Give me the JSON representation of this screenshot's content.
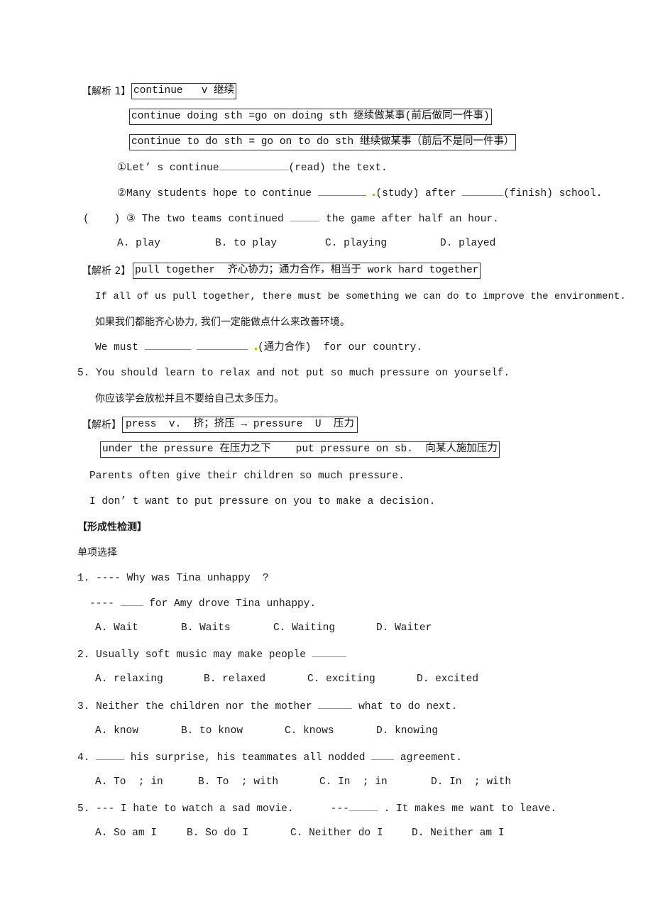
{
  "section1": {
    "label": "【解析 1】",
    "box_main": "continue   v 继续",
    "box_doing": "continue doing sth =go on doing sth 继续做某事(前后做同一件事)",
    "box_to_do": "continue to do sth = go on to do sth 继续做某事（前后不是同一件事）",
    "ex1_pre": "①Let’ s continue",
    "ex1_post": "(read) the text.",
    "ex2_pre": "②Many students hope to continue",
    "ex2_mid": "(study) after",
    "ex2_post": "(finish) school.",
    "ex3_paren": "(    )",
    "ex3_pre": "③ The two teams continued",
    "ex3_post": "the game after half an hour.",
    "ex3_options": [
      "A. play",
      "B. to play",
      "C. playing",
      "D. played"
    ]
  },
  "section2": {
    "label": "【解析 2】",
    "box": "pull together  齐心协力；通力合作，相当于 work hard together",
    "example_en": "If all of us pull together, there must be something we can do to improve the environment.",
    "example_zh": "如果我们都能齐心协力, 我们一定能做点什么来改善环境。",
    "fill_pre": "We must",
    "fill_hint": "(通力合作)",
    "fill_post": "for our country."
  },
  "sentence5": {
    "en": "5. You should learn to relax and not put so much pressure on yourself.",
    "zh": "你应该学会放松并且不要给自己太多压力。"
  },
  "section3": {
    "label": "【解析】",
    "box1": "press  v.  挤；挤压 → pressure  U  压力",
    "box2": "under the pressure 在压力之下    put pressure on sb.  向某人施加压力",
    "example1": "Parents often give their children so much pressure.",
    "example2": "I don’ t want to put pressure on you to make a decision."
  },
  "assessment": {
    "title": "【形成性检测】",
    "subtitle": "单项选择",
    "questions": [
      {
        "line1": "1. ---- Why was Tina unhappy  ?",
        "line2_pre": "---- ",
        "line2_post": " for Amy drove Tina unhappy.",
        "options": [
          "A. Wait",
          "B. Waits",
          "C. Waiting",
          "D. Waiter"
        ]
      },
      {
        "line1_pre": "2. Usually soft music may make people",
        "options": [
          "A. relaxing",
          "B. relaxed",
          "C. exciting",
          "D. excited"
        ]
      },
      {
        "line1_pre": "3. Neither the children nor the mother",
        "line1_post": "what to do next.",
        "options": [
          "A. know",
          "B. to know",
          "C. knows",
          "D. knowing"
        ]
      },
      {
        "line1_pre": "4.",
        "line1_mid": "his surprise, his teammates all nodded",
        "line1_post": "agreement.",
        "options": [
          "A. To  ; in",
          "B. To  ; with",
          "C. In  ; in",
          "D. In  ; with"
        ]
      },
      {
        "line1_pre": "5. --- I hate to watch a sad movie.",
        "line1_dash": "---",
        "line1_post": ". It makes me want to leave.",
        "options": [
          "A. So am I",
          "B. So do I",
          "C. Neither do I",
          "D. Neither am I"
        ]
      }
    ]
  }
}
